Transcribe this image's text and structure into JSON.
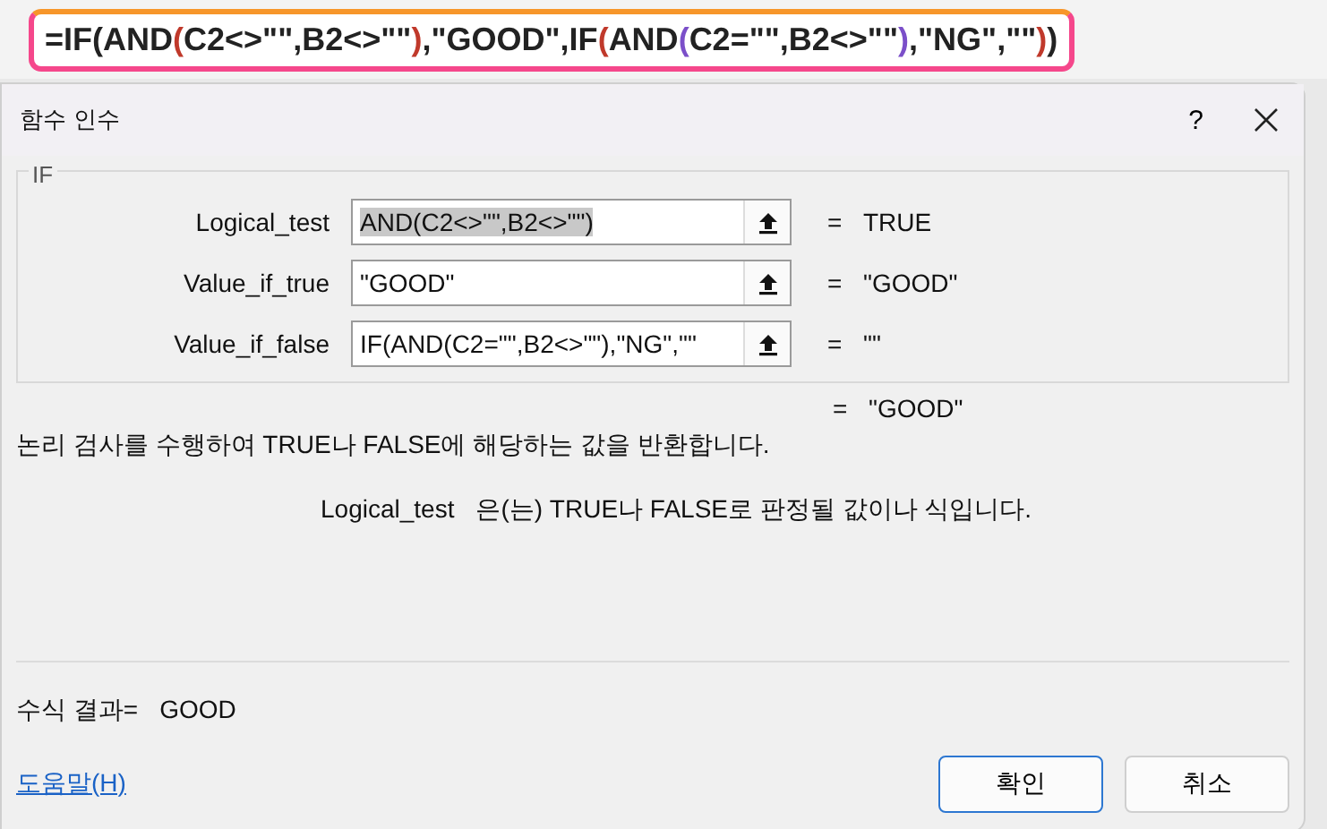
{
  "formula_bar": {
    "segments": [
      {
        "text": "=IF",
        "color": "#222222"
      },
      {
        "text": "(",
        "color": "#222222"
      },
      {
        "text": "AND",
        "color": "#222222"
      },
      {
        "text": "(",
        "color": "#c0392b"
      },
      {
        "text": "C2<>\"\",B2<>\"\"",
        "color": "#222222"
      },
      {
        "text": ")",
        "color": "#c0392b"
      },
      {
        "text": ",\"GOOD\",IF",
        "color": "#222222"
      },
      {
        "text": "(",
        "color": "#c0392b"
      },
      {
        "text": "AND",
        "color": "#222222"
      },
      {
        "text": "(",
        "color": "#7b4fc9"
      },
      {
        "text": "C2=\"\",B2<>\"\"",
        "color": "#222222"
      },
      {
        "text": ")",
        "color": "#7b4fc9"
      },
      {
        "text": ",\"NG\",\"\"",
        "color": "#222222"
      },
      {
        "text": ")",
        "color": "#c0392b"
      },
      {
        "text": ")",
        "color": "#222222"
      }
    ]
  },
  "dialog": {
    "title": "함수 인수",
    "help_glyph": "?",
    "group_label": "IF",
    "arguments": [
      {
        "label": "Logical_test",
        "value": "AND(C2<>\"\",B2<>\"\")",
        "selected": true,
        "equals": "=",
        "result": "TRUE"
      },
      {
        "label": "Value_if_true",
        "value": "\"GOOD\"",
        "selected": false,
        "equals": "=",
        "result": "\"GOOD\""
      },
      {
        "label": "Value_if_false",
        "value": "IF(AND(C2=\"\",B2<>\"\"),\"NG\",\"\"",
        "selected": false,
        "equals": "=",
        "result": "\"\""
      }
    ],
    "overall_equals": "=",
    "overall_result": "\"GOOD\"",
    "description": "논리 검사를 수행하여 TRUE나 FALSE에 해당하는 값을 반환합니다.",
    "arg_name": "Logical_test",
    "arg_help": "은(는) TRUE나 FALSE로 판정될 값이나 식입니다.",
    "formula_result_label": "수식 결과=",
    "formula_result": "GOOD",
    "help_link": "도움말(H)",
    "buttons": [
      {
        "label": "확인",
        "kind": "primary"
      },
      {
        "label": "취소",
        "kind": "secondary"
      }
    ]
  }
}
